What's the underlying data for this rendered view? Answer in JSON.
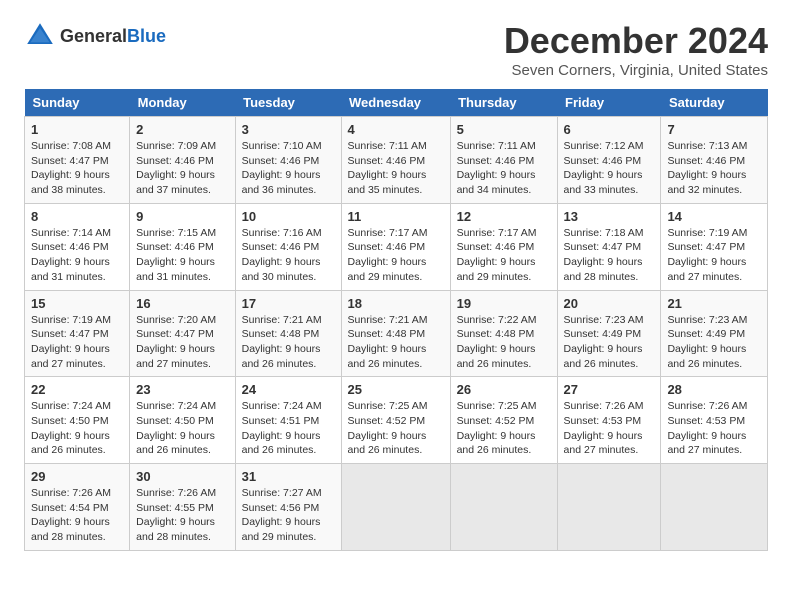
{
  "header": {
    "logo_general": "General",
    "logo_blue": "Blue",
    "month_title": "December 2024",
    "location": "Seven Corners, Virginia, United States"
  },
  "weekdays": [
    "Sunday",
    "Monday",
    "Tuesday",
    "Wednesday",
    "Thursday",
    "Friday",
    "Saturday"
  ],
  "weeks": [
    [
      {
        "day": "1",
        "sunrise": "Sunrise: 7:08 AM",
        "sunset": "Sunset: 4:47 PM",
        "daylight": "Daylight: 9 hours and 38 minutes."
      },
      {
        "day": "2",
        "sunrise": "Sunrise: 7:09 AM",
        "sunset": "Sunset: 4:46 PM",
        "daylight": "Daylight: 9 hours and 37 minutes."
      },
      {
        "day": "3",
        "sunrise": "Sunrise: 7:10 AM",
        "sunset": "Sunset: 4:46 PM",
        "daylight": "Daylight: 9 hours and 36 minutes."
      },
      {
        "day": "4",
        "sunrise": "Sunrise: 7:11 AM",
        "sunset": "Sunset: 4:46 PM",
        "daylight": "Daylight: 9 hours and 35 minutes."
      },
      {
        "day": "5",
        "sunrise": "Sunrise: 7:11 AM",
        "sunset": "Sunset: 4:46 PM",
        "daylight": "Daylight: 9 hours and 34 minutes."
      },
      {
        "day": "6",
        "sunrise": "Sunrise: 7:12 AM",
        "sunset": "Sunset: 4:46 PM",
        "daylight": "Daylight: 9 hours and 33 minutes."
      },
      {
        "day": "7",
        "sunrise": "Sunrise: 7:13 AM",
        "sunset": "Sunset: 4:46 PM",
        "daylight": "Daylight: 9 hours and 32 minutes."
      }
    ],
    [
      {
        "day": "8",
        "sunrise": "Sunrise: 7:14 AM",
        "sunset": "Sunset: 4:46 PM",
        "daylight": "Daylight: 9 hours and 31 minutes."
      },
      {
        "day": "9",
        "sunrise": "Sunrise: 7:15 AM",
        "sunset": "Sunset: 4:46 PM",
        "daylight": "Daylight: 9 hours and 31 minutes."
      },
      {
        "day": "10",
        "sunrise": "Sunrise: 7:16 AM",
        "sunset": "Sunset: 4:46 PM",
        "daylight": "Daylight: 9 hours and 30 minutes."
      },
      {
        "day": "11",
        "sunrise": "Sunrise: 7:17 AM",
        "sunset": "Sunset: 4:46 PM",
        "daylight": "Daylight: 9 hours and 29 minutes."
      },
      {
        "day": "12",
        "sunrise": "Sunrise: 7:17 AM",
        "sunset": "Sunset: 4:46 PM",
        "daylight": "Daylight: 9 hours and 29 minutes."
      },
      {
        "day": "13",
        "sunrise": "Sunrise: 7:18 AM",
        "sunset": "Sunset: 4:47 PM",
        "daylight": "Daylight: 9 hours and 28 minutes."
      },
      {
        "day": "14",
        "sunrise": "Sunrise: 7:19 AM",
        "sunset": "Sunset: 4:47 PM",
        "daylight": "Daylight: 9 hours and 27 minutes."
      }
    ],
    [
      {
        "day": "15",
        "sunrise": "Sunrise: 7:19 AM",
        "sunset": "Sunset: 4:47 PM",
        "daylight": "Daylight: 9 hours and 27 minutes."
      },
      {
        "day": "16",
        "sunrise": "Sunrise: 7:20 AM",
        "sunset": "Sunset: 4:47 PM",
        "daylight": "Daylight: 9 hours and 27 minutes."
      },
      {
        "day": "17",
        "sunrise": "Sunrise: 7:21 AM",
        "sunset": "Sunset: 4:48 PM",
        "daylight": "Daylight: 9 hours and 26 minutes."
      },
      {
        "day": "18",
        "sunrise": "Sunrise: 7:21 AM",
        "sunset": "Sunset: 4:48 PM",
        "daylight": "Daylight: 9 hours and 26 minutes."
      },
      {
        "day": "19",
        "sunrise": "Sunrise: 7:22 AM",
        "sunset": "Sunset: 4:48 PM",
        "daylight": "Daylight: 9 hours and 26 minutes."
      },
      {
        "day": "20",
        "sunrise": "Sunrise: 7:23 AM",
        "sunset": "Sunset: 4:49 PM",
        "daylight": "Daylight: 9 hours and 26 minutes."
      },
      {
        "day": "21",
        "sunrise": "Sunrise: 7:23 AM",
        "sunset": "Sunset: 4:49 PM",
        "daylight": "Daylight: 9 hours and 26 minutes."
      }
    ],
    [
      {
        "day": "22",
        "sunrise": "Sunrise: 7:24 AM",
        "sunset": "Sunset: 4:50 PM",
        "daylight": "Daylight: 9 hours and 26 minutes."
      },
      {
        "day": "23",
        "sunrise": "Sunrise: 7:24 AM",
        "sunset": "Sunset: 4:50 PM",
        "daylight": "Daylight: 9 hours and 26 minutes."
      },
      {
        "day": "24",
        "sunrise": "Sunrise: 7:24 AM",
        "sunset": "Sunset: 4:51 PM",
        "daylight": "Daylight: 9 hours and 26 minutes."
      },
      {
        "day": "25",
        "sunrise": "Sunrise: 7:25 AM",
        "sunset": "Sunset: 4:52 PM",
        "daylight": "Daylight: 9 hours and 26 minutes."
      },
      {
        "day": "26",
        "sunrise": "Sunrise: 7:25 AM",
        "sunset": "Sunset: 4:52 PM",
        "daylight": "Daylight: 9 hours and 26 minutes."
      },
      {
        "day": "27",
        "sunrise": "Sunrise: 7:26 AM",
        "sunset": "Sunset: 4:53 PM",
        "daylight": "Daylight: 9 hours and 27 minutes."
      },
      {
        "day": "28",
        "sunrise": "Sunrise: 7:26 AM",
        "sunset": "Sunset: 4:53 PM",
        "daylight": "Daylight: 9 hours and 27 minutes."
      }
    ],
    [
      {
        "day": "29",
        "sunrise": "Sunrise: 7:26 AM",
        "sunset": "Sunset: 4:54 PM",
        "daylight": "Daylight: 9 hours and 28 minutes."
      },
      {
        "day": "30",
        "sunrise": "Sunrise: 7:26 AM",
        "sunset": "Sunset: 4:55 PM",
        "daylight": "Daylight: 9 hours and 28 minutes."
      },
      {
        "day": "31",
        "sunrise": "Sunrise: 7:27 AM",
        "sunset": "Sunset: 4:56 PM",
        "daylight": "Daylight: 9 hours and 29 minutes."
      },
      null,
      null,
      null,
      null
    ]
  ]
}
